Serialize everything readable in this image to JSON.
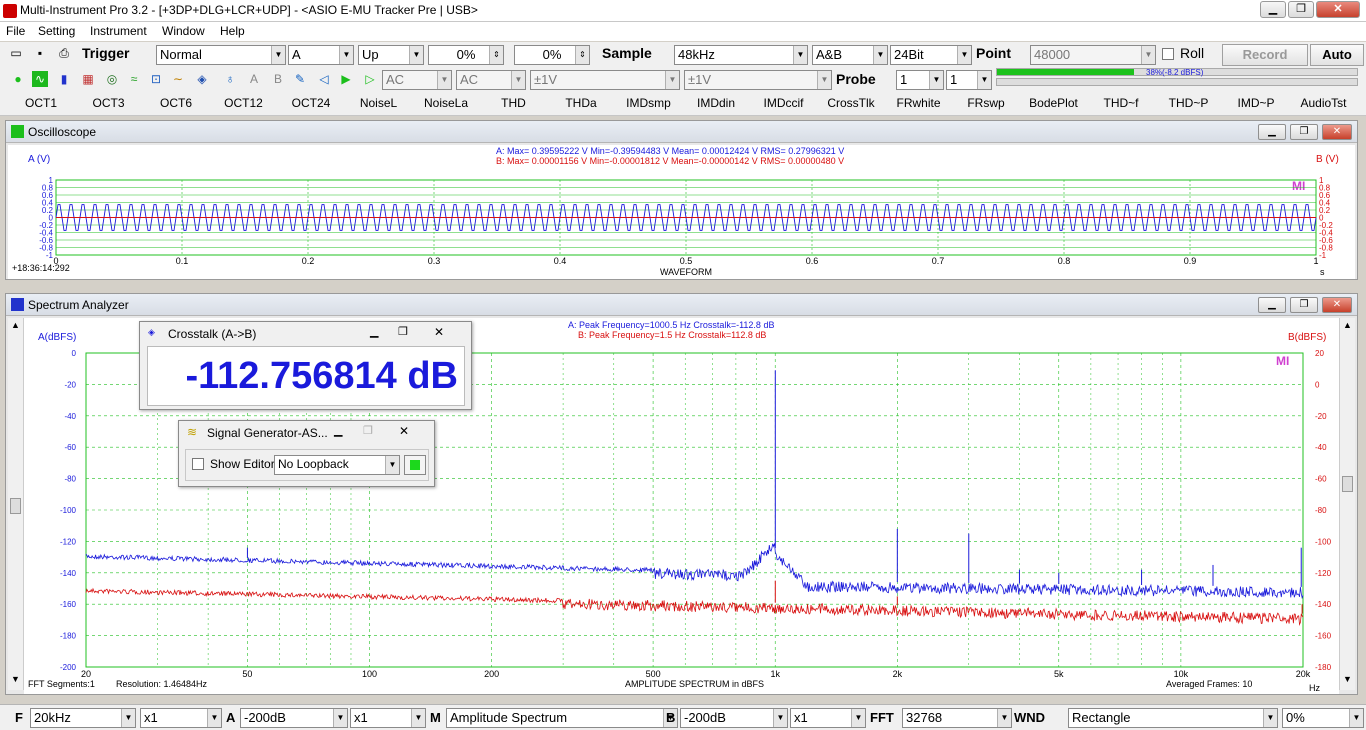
{
  "window": {
    "title": "Multi-Instrument Pro 3.2    -    [+3DP+DLG+LCR+UDP]    -    <ASIO E-MU Tracker Pre | USB>"
  },
  "menu": [
    "File",
    "Setting",
    "Instrument",
    "Window",
    "Help"
  ],
  "toolbar1": {
    "trigger_label": "Trigger",
    "trigger_mode": "Normal",
    "trigger_channel": "A",
    "trigger_edge": "Up",
    "trigger_level": "0%",
    "trigger_delay": "0%",
    "sample_label": "Sample",
    "sample_rate": "48kHz",
    "channels": "A&B",
    "bit_depth": "24Bit",
    "point_label": "Point",
    "point_value": "48000",
    "roll_label": "Roll",
    "record_label": "Record",
    "auto_label": "Auto"
  },
  "toolbar2": {
    "coupling_a": "AC",
    "coupling_b": "AC",
    "range_a": "±1V",
    "range_b": "±1V",
    "probe_label": "Probe",
    "probe_a": "1",
    "probe_b": "1",
    "level_meter_text": "38%(-8.2 dBFS)",
    "level_meter_fill": 0.38
  },
  "function_bar": [
    "OCT1",
    "OCT3",
    "OCT6",
    "OCT12",
    "OCT24",
    "NoiseL",
    "NoiseLa",
    "THD",
    "THDa",
    "IMDsmp",
    "IMDdin",
    "IMDccif",
    "CrossTlk",
    "FRwhite",
    "FRswp",
    "BodePlot",
    "THD~f",
    "THD~P",
    "IMD~P",
    "AudioTst"
  ],
  "oscilloscope": {
    "title": "Oscilloscope",
    "a_axis_label": "A (V)",
    "b_axis_label": "B (V)",
    "stats_a": "A: Max= 0.39595222 V  Min=-0.39594483 V  Mean= 0.00012424 V  RMS= 0.27996321 V",
    "stats_b": "B: Max= 0.00001156 V  Min=-0.00001812 V  Mean=-0.00000142 V  RMS= 0.00000480 V",
    "y_ticks": [
      "1",
      "0.8",
      "0.6",
      "0.4",
      "0.2",
      "0",
      "-0.2",
      "-0.4",
      "-0.6",
      "-0.8",
      "-1"
    ],
    "x_ticks": [
      "0",
      "0.1",
      "0.2",
      "0.3",
      "0.4",
      "0.5",
      "0.6",
      "0.7",
      "0.8",
      "0.9",
      "1"
    ],
    "x_unit": "s",
    "x_caption": "WAVEFORM",
    "timestamp": "+18:36:14:292",
    "logo": "MI"
  },
  "spectrum": {
    "title": "Spectrum Analyzer",
    "a_axis_label": "A(dBFS)",
    "b_axis_label": "B(dBFS)",
    "peak_a": "A: Peak Frequency=1000.5 Hz  Crosstalk=-112.8 dB",
    "peak_b": "B: Peak Frequency=1.5 Hz  Crosstalk=112.8 dB",
    "y_left_ticks": [
      "0",
      "-20",
      "-40",
      "-60",
      "-80",
      "-100",
      "-120",
      "-140",
      "-160",
      "-180",
      "-200"
    ],
    "y_right_ticks": [
      "20",
      "0",
      "-20",
      "-40",
      "-60",
      "-80",
      "-100",
      "-120",
      "-140",
      "-160",
      "-180"
    ],
    "x_ticks": [
      "20",
      "50",
      "100",
      "200",
      "500",
      "1k",
      "2k",
      "5k",
      "10k",
      "20k"
    ],
    "x_unit": "Hz",
    "x_caption": "AMPLITUDE SPECTRUM in dBFS",
    "fft_segments": "FFT Segments:1",
    "resolution": "Resolution: 1.46484Hz",
    "averaged": "Averaged Frames: 10",
    "logo": "MI"
  },
  "crosstalk_window": {
    "title": "Crosstalk (A->B)",
    "value": "-112.756814 dB"
  },
  "siggen_window": {
    "title": "Signal Generator-AS...",
    "show_editor": "Show Editor",
    "loopback": "No Loopback"
  },
  "bottom_bar": {
    "f_label": "F",
    "f_range": "20kHz",
    "f_mult": "x1",
    "a_label": "A",
    "a_range": "-200dB",
    "a_mult": "x1",
    "m_label": "M",
    "m_mode": "Amplitude Spectrum",
    "b_label": "B",
    "b_range": "-200dB",
    "b_mult": "x1",
    "fft_label": "FFT",
    "fft_size": "32768",
    "wnd_label": "WND",
    "window_fn": "Rectangle",
    "overlap": "0%"
  },
  "colors": {
    "channel_a": "#1a1adb",
    "channel_b": "#d81010",
    "grid": "#22c022",
    "accent": "#3a8f3a"
  }
}
